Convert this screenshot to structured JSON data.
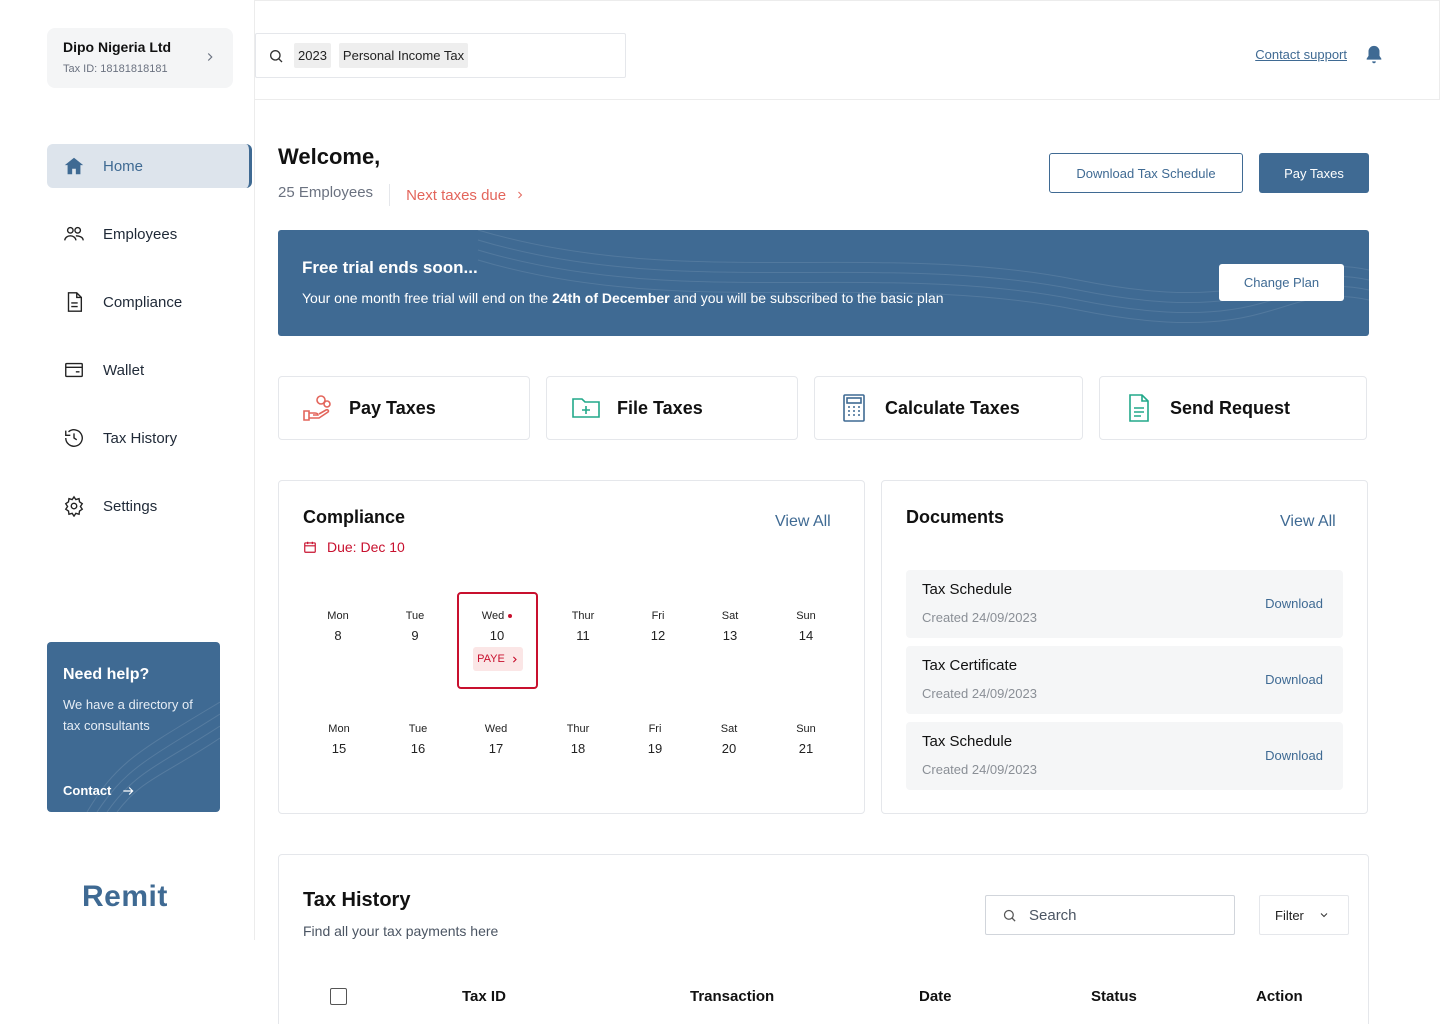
{
  "org": {
    "name": "Dipo Nigeria Ltd",
    "tax_id": "Tax ID: 18181818181"
  },
  "nav": [
    {
      "label": "Home",
      "icon": "home-icon"
    },
    {
      "label": "Employees",
      "icon": "users-icon"
    },
    {
      "label": "Compliance",
      "icon": "document-icon"
    },
    {
      "label": "Wallet",
      "icon": "wallet-icon"
    },
    {
      "label": "Tax History",
      "icon": "history-icon"
    },
    {
      "label": "Settings",
      "icon": "gear-icon"
    }
  ],
  "help": {
    "title": "Need help?",
    "text": "We have a directory of tax consultants",
    "contact": "Contact"
  },
  "logo": "Remit",
  "topbar": {
    "year_chip": "2023",
    "type_chip": "Personal Income Tax",
    "contact_support": "Contact support"
  },
  "welcome": {
    "title": "Welcome,",
    "employees": "25 Employees",
    "next_due": "Next taxes due"
  },
  "buttons": {
    "download_schedule": "Download Tax Schedule",
    "pay_taxes": "Pay Taxes"
  },
  "banner": {
    "title": "Free trial ends soon...",
    "text_before": "Your one month free trial will end on the ",
    "text_bold": "24th of December",
    "text_after": " and you will be subscribed to the basic plan",
    "button": "Change Plan"
  },
  "actions": [
    {
      "label": "Pay Taxes",
      "icon": "hand-coins-icon",
      "color": "#e3655b"
    },
    {
      "label": "File Taxes",
      "icon": "folder-plus-icon",
      "color": "#22a98a"
    },
    {
      "label": "Calculate Taxes",
      "icon": "calculator-icon",
      "color": "#3f6a93"
    },
    {
      "label": "Send Request",
      "icon": "file-text-icon",
      "color": "#22a98a"
    }
  ],
  "compliance": {
    "title": "Compliance",
    "view_all": "View All",
    "due": "Due: Dec 10",
    "week1": [
      {
        "name": "Mon",
        "num": "8"
      },
      {
        "name": "Tue",
        "num": "9"
      },
      {
        "name": "Wed",
        "num": "10"
      },
      {
        "name": "Thur",
        "num": "11"
      },
      {
        "name": "Fri",
        "num": "12"
      },
      {
        "name": "Sat",
        "num": "13"
      },
      {
        "name": "Sun",
        "num": "14"
      }
    ],
    "week2": [
      {
        "name": "Mon",
        "num": "15"
      },
      {
        "name": "Tue",
        "num": "16"
      },
      {
        "name": "Wed",
        "num": "17"
      },
      {
        "name": "Thur",
        "num": "18"
      },
      {
        "name": "Fri",
        "num": "19"
      },
      {
        "name": "Sat",
        "num": "20"
      },
      {
        "name": "Sun",
        "num": "21"
      }
    ],
    "tag": "PAYE"
  },
  "documents": {
    "title": "Documents",
    "view_all": "View All",
    "items": [
      {
        "name": "Tax Schedule",
        "date": "Created 24/09/2023",
        "action": "Download"
      },
      {
        "name": "Tax Certificate",
        "date": "Created 24/09/2023",
        "action": "Download"
      },
      {
        "name": "Tax Schedule",
        "date": "Created 24/09/2023",
        "action": "Download"
      }
    ]
  },
  "history": {
    "title": "Tax History",
    "subtitle": "Find all your tax payments here",
    "search_placeholder": "Search",
    "filter": "Filter",
    "columns": [
      "Tax ID",
      "Transaction",
      "Date",
      "Status",
      "Action"
    ]
  },
  "colors": {
    "primary": "#3f6a93",
    "danger": "#c8102e",
    "accent": "#e3655b",
    "green": "#22a98a"
  }
}
